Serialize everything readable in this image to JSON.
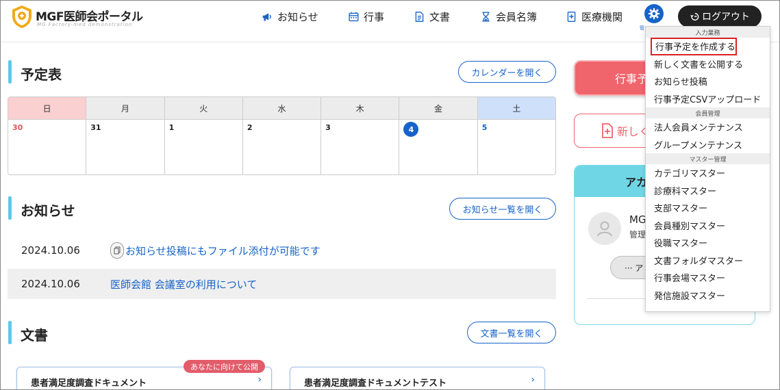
{
  "header": {
    "logo_title": "MGF医師会ポータル",
    "logo_subtitle": "MG Factory-med demonstration",
    "nav": [
      {
        "label": "お知らせ",
        "icon": "megaphone-icon"
      },
      {
        "label": "行事",
        "icon": "calendar-icon"
      },
      {
        "label": "文書",
        "icon": "document-icon"
      },
      {
        "label": "会員名簿",
        "icon": "hourglass-icon"
      },
      {
        "label": "医療機関",
        "icon": "hospital-icon"
      }
    ],
    "admin_caption": "管",
    "logout_label": "ログアウト"
  },
  "schedule": {
    "title": "予定表",
    "open_button": "カレンダーを開く",
    "weekdays": [
      "日",
      "月",
      "火",
      "水",
      "木",
      "金",
      "土"
    ],
    "dates": [
      "30",
      "31",
      "1",
      "2",
      "3",
      "4",
      "5"
    ]
  },
  "news": {
    "title": "お知らせ",
    "open_button": "お知らせ一覧を開く",
    "items": [
      {
        "date": "2024.10.06",
        "title": "お知らせ投稿にもファイル添付が可能です"
      },
      {
        "date": "2024.10.06",
        "title": "医師会館 会議室の利用について"
      }
    ]
  },
  "documents": {
    "title": "文書",
    "open_button": "文書一覧を開く",
    "badge": "あなたに向けて公開",
    "cards": [
      {
        "title": "患者満足度調査ドキュメント"
      },
      {
        "title": "患者満足度調査ドキュメントテスト"
      }
    ]
  },
  "side": {
    "button1": "行事予",
    "button2": "新しく",
    "account_header": "アカ",
    "account_name": "MG",
    "account_role": "管理",
    "account_button": "··· ア"
  },
  "dropdown": {
    "groups": [
      {
        "label": "入力業務",
        "items": [
          "行事予定を作成する",
          "新しく文書を公開する",
          "お知らせ投稿",
          "行事予定CSVアップロード"
        ]
      },
      {
        "label": "会員管理",
        "items": [
          "法人会員メンテナンス",
          "グループメンテナンス"
        ]
      },
      {
        "label": "マスター管理",
        "items": [
          "カテゴリマスター",
          "診療科マスター",
          "支部マスター",
          "会員種別マスター",
          "役職マスター",
          "文書フォルダマスター",
          "行事会場マスター",
          "発信施設マスター"
        ]
      }
    ]
  },
  "colors": {
    "accent": "#1763c9",
    "section_bar": "#5ec8e8",
    "badge": "#e25c6a",
    "highlight_border": "#d92020"
  }
}
